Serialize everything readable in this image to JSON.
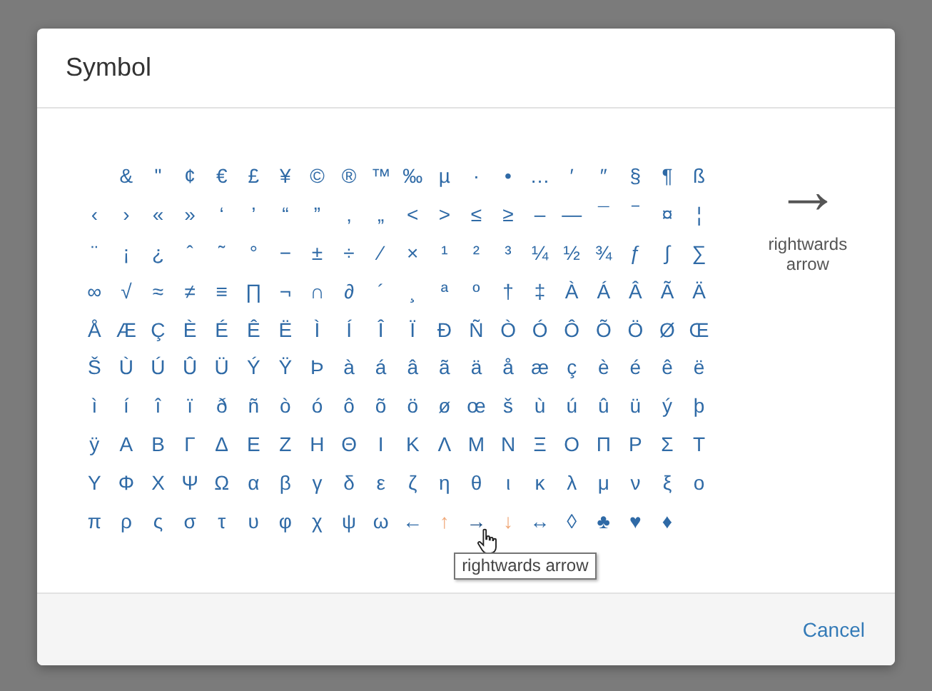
{
  "dialog": {
    "title": "Symbol",
    "grid": [
      {
        "indented": true,
        "cells": [
          {
            "char": "&",
            "hovered": false
          },
          {
            "char": "\"",
            "hovered": false
          },
          {
            "char": "¢",
            "hovered": false
          },
          {
            "char": "€",
            "hovered": false
          },
          {
            "char": "£",
            "hovered": false
          },
          {
            "char": "¥",
            "hovered": false
          },
          {
            "char": "©",
            "hovered": false
          },
          {
            "char": "®",
            "hovered": false
          },
          {
            "char": "™",
            "hovered": false
          },
          {
            "char": "‰",
            "hovered": false
          },
          {
            "char": "µ",
            "hovered": false
          },
          {
            "char": "·",
            "hovered": false
          },
          {
            "char": "•",
            "hovered": false
          },
          {
            "char": "…",
            "hovered": false
          },
          {
            "char": "′",
            "hovered": false
          },
          {
            "char": "″",
            "hovered": false
          },
          {
            "char": "§",
            "hovered": false
          },
          {
            "char": "¶",
            "hovered": false
          },
          {
            "char": "ß",
            "hovered": false
          }
        ]
      },
      {
        "indented": false,
        "cells": [
          {
            "char": "‹",
            "hovered": false
          },
          {
            "char": "›",
            "hovered": false
          },
          {
            "char": "«",
            "hovered": false
          },
          {
            "char": "»",
            "hovered": false
          },
          {
            "char": "‘",
            "hovered": false
          },
          {
            "char": "’",
            "hovered": false
          },
          {
            "char": "“",
            "hovered": false
          },
          {
            "char": "”",
            "hovered": false
          },
          {
            "char": "‚",
            "hovered": false
          },
          {
            "char": "„",
            "hovered": false
          },
          {
            "char": "<",
            "hovered": false
          },
          {
            "char": ">",
            "hovered": false
          },
          {
            "char": "≤",
            "hovered": false
          },
          {
            "char": "≥",
            "hovered": false
          },
          {
            "char": "–",
            "hovered": false
          },
          {
            "char": "—",
            "hovered": false
          },
          {
            "char": "¯",
            "hovered": false
          },
          {
            "char": "‾",
            "hovered": false
          },
          {
            "char": "¤",
            "hovered": false
          },
          {
            "char": "¦",
            "hovered": false
          }
        ]
      },
      {
        "indented": false,
        "cells": [
          {
            "char": "¨",
            "hovered": false
          },
          {
            "char": "¡",
            "hovered": false
          },
          {
            "char": "¿",
            "hovered": false
          },
          {
            "char": "ˆ",
            "hovered": false
          },
          {
            "char": "˜",
            "hovered": false
          },
          {
            "char": "°",
            "hovered": false
          },
          {
            "char": "−",
            "hovered": false
          },
          {
            "char": "±",
            "hovered": false
          },
          {
            "char": "÷",
            "hovered": false
          },
          {
            "char": "⁄",
            "hovered": false
          },
          {
            "char": "×",
            "hovered": false
          },
          {
            "char": "¹",
            "hovered": false
          },
          {
            "char": "²",
            "hovered": false
          },
          {
            "char": "³",
            "hovered": false
          },
          {
            "char": "¼",
            "hovered": false
          },
          {
            "char": "½",
            "hovered": false
          },
          {
            "char": "¾",
            "hovered": false
          },
          {
            "char": "ƒ",
            "hovered": false
          },
          {
            "char": "∫",
            "hovered": false
          },
          {
            "char": "∑",
            "hovered": false
          }
        ]
      },
      {
        "indented": false,
        "cells": [
          {
            "char": "∞",
            "hovered": false
          },
          {
            "char": "√",
            "hovered": false
          },
          {
            "char": "≈",
            "hovered": false
          },
          {
            "char": "≠",
            "hovered": false
          },
          {
            "char": "≡",
            "hovered": false
          },
          {
            "char": "∏",
            "hovered": false
          },
          {
            "char": "¬",
            "hovered": false
          },
          {
            "char": "∩",
            "hovered": false
          },
          {
            "char": "∂",
            "hovered": false
          },
          {
            "char": "´",
            "hovered": false
          },
          {
            "char": "¸",
            "hovered": false
          },
          {
            "char": "ª",
            "hovered": false
          },
          {
            "char": "º",
            "hovered": false
          },
          {
            "char": "†",
            "hovered": false
          },
          {
            "char": "‡",
            "hovered": false
          },
          {
            "char": "À",
            "hovered": false
          },
          {
            "char": "Á",
            "hovered": false
          },
          {
            "char": "Â",
            "hovered": false
          },
          {
            "char": "Ã",
            "hovered": false
          },
          {
            "char": "Ä",
            "hovered": false
          }
        ]
      },
      {
        "indented": false,
        "cells": [
          {
            "char": "Å",
            "hovered": false
          },
          {
            "char": "Æ",
            "hovered": false
          },
          {
            "char": "Ç",
            "hovered": false
          },
          {
            "char": "È",
            "hovered": false
          },
          {
            "char": "É",
            "hovered": false
          },
          {
            "char": "Ê",
            "hovered": false
          },
          {
            "char": "Ë",
            "hovered": false
          },
          {
            "char": "Ì",
            "hovered": false
          },
          {
            "char": "Í",
            "hovered": false
          },
          {
            "char": "Î",
            "hovered": false
          },
          {
            "char": "Ï",
            "hovered": false
          },
          {
            "char": "Ð",
            "hovered": false
          },
          {
            "char": "Ñ",
            "hovered": false
          },
          {
            "char": "Ò",
            "hovered": false
          },
          {
            "char": "Ó",
            "hovered": false
          },
          {
            "char": "Ô",
            "hovered": false
          },
          {
            "char": "Õ",
            "hovered": false
          },
          {
            "char": "Ö",
            "hovered": false
          },
          {
            "char": "Ø",
            "hovered": false
          },
          {
            "char": "Œ",
            "hovered": false
          }
        ]
      },
      {
        "indented": false,
        "cells": [
          {
            "char": "Š",
            "hovered": false
          },
          {
            "char": "Ù",
            "hovered": false
          },
          {
            "char": "Ú",
            "hovered": false
          },
          {
            "char": "Û",
            "hovered": false
          },
          {
            "char": "Ü",
            "hovered": false
          },
          {
            "char": "Ý",
            "hovered": false
          },
          {
            "char": "Ÿ",
            "hovered": false
          },
          {
            "char": "Þ",
            "hovered": false
          },
          {
            "char": "à",
            "hovered": false
          },
          {
            "char": "á",
            "hovered": false
          },
          {
            "char": "â",
            "hovered": false
          },
          {
            "char": "ã",
            "hovered": false
          },
          {
            "char": "ä",
            "hovered": false
          },
          {
            "char": "å",
            "hovered": false
          },
          {
            "char": "æ",
            "hovered": false
          },
          {
            "char": "ç",
            "hovered": false
          },
          {
            "char": "è",
            "hovered": false
          },
          {
            "char": "é",
            "hovered": false
          },
          {
            "char": "ê",
            "hovered": false
          },
          {
            "char": "ë",
            "hovered": false
          }
        ]
      },
      {
        "indented": false,
        "cells": [
          {
            "char": "ì",
            "hovered": false
          },
          {
            "char": "í",
            "hovered": false
          },
          {
            "char": "î",
            "hovered": false
          },
          {
            "char": "ï",
            "hovered": false
          },
          {
            "char": "ð",
            "hovered": false
          },
          {
            "char": "ñ",
            "hovered": false
          },
          {
            "char": "ò",
            "hovered": false
          },
          {
            "char": "ó",
            "hovered": false
          },
          {
            "char": "ô",
            "hovered": false
          },
          {
            "char": "õ",
            "hovered": false
          },
          {
            "char": "ö",
            "hovered": false
          },
          {
            "char": "ø",
            "hovered": false
          },
          {
            "char": "œ",
            "hovered": false
          },
          {
            "char": "š",
            "hovered": false
          },
          {
            "char": "ù",
            "hovered": false
          },
          {
            "char": "ú",
            "hovered": false
          },
          {
            "char": "û",
            "hovered": false
          },
          {
            "char": "ü",
            "hovered": false
          },
          {
            "char": "ý",
            "hovered": false
          },
          {
            "char": "þ",
            "hovered": false
          }
        ]
      },
      {
        "indented": false,
        "cells": [
          {
            "char": "ÿ",
            "hovered": false
          },
          {
            "char": "Α",
            "hovered": false
          },
          {
            "char": "Β",
            "hovered": false
          },
          {
            "char": "Γ",
            "hovered": false
          },
          {
            "char": "Δ",
            "hovered": false
          },
          {
            "char": "Ε",
            "hovered": false
          },
          {
            "char": "Ζ",
            "hovered": false
          },
          {
            "char": "Η",
            "hovered": false
          },
          {
            "char": "Θ",
            "hovered": false
          },
          {
            "char": "Ι",
            "hovered": false
          },
          {
            "char": "Κ",
            "hovered": false
          },
          {
            "char": "Λ",
            "hovered": false
          },
          {
            "char": "Μ",
            "hovered": false
          },
          {
            "char": "Ν",
            "hovered": false
          },
          {
            "char": "Ξ",
            "hovered": false
          },
          {
            "char": "Ο",
            "hovered": false
          },
          {
            "char": "Π",
            "hovered": false
          },
          {
            "char": "Ρ",
            "hovered": false
          },
          {
            "char": "Σ",
            "hovered": false
          },
          {
            "char": "Τ",
            "hovered": false
          }
        ]
      },
      {
        "indented": false,
        "cells": [
          {
            "char": "Υ",
            "hovered": false
          },
          {
            "char": "Φ",
            "hovered": false
          },
          {
            "char": "Χ",
            "hovered": false
          },
          {
            "char": "Ψ",
            "hovered": false
          },
          {
            "char": "Ω",
            "hovered": false
          },
          {
            "char": "α",
            "hovered": false
          },
          {
            "char": "β",
            "hovered": false
          },
          {
            "char": "γ",
            "hovered": false
          },
          {
            "char": "δ",
            "hovered": false
          },
          {
            "char": "ε",
            "hovered": false
          },
          {
            "char": "ζ",
            "hovered": false
          },
          {
            "char": "η",
            "hovered": false
          },
          {
            "char": "θ",
            "hovered": false
          },
          {
            "char": "ι",
            "hovered": false
          },
          {
            "char": "κ",
            "hovered": false
          },
          {
            "char": "λ",
            "hovered": false
          },
          {
            "char": "μ",
            "hovered": false
          },
          {
            "char": "ν",
            "hovered": false
          },
          {
            "char": "ξ",
            "hovered": false
          },
          {
            "char": "ο",
            "hovered": false
          }
        ]
      },
      {
        "indented": false,
        "cells": [
          {
            "char": "π",
            "hovered": false
          },
          {
            "char": "ρ",
            "hovered": false
          },
          {
            "char": "ς",
            "hovered": false
          },
          {
            "char": "σ",
            "hovered": false
          },
          {
            "char": "τ",
            "hovered": false
          },
          {
            "char": "υ",
            "hovered": false
          },
          {
            "char": "φ",
            "hovered": false
          },
          {
            "char": "χ",
            "hovered": false
          },
          {
            "char": "ψ",
            "hovered": false
          },
          {
            "char": "ω",
            "hovered": false
          },
          {
            "char": "←",
            "hovered": false
          },
          {
            "char": "↑",
            "hovered": false,
            "color": "#f0a878"
          },
          {
            "char": "→",
            "hovered": true
          },
          {
            "char": "↓",
            "hovered": false,
            "color": "#f0a878"
          },
          {
            "char": "↔",
            "hovered": false
          },
          {
            "char": "◊",
            "hovered": false
          },
          {
            "char": "♣",
            "hovered": false
          },
          {
            "char": "♥",
            "hovered": false
          },
          {
            "char": "♦",
            "hovered": false
          }
        ]
      }
    ],
    "tooltip": "rightwards arrow",
    "preview": {
      "symbol": "→",
      "name": "rightwards arrow"
    },
    "buttons": [
      {
        "label": "Cancel"
      }
    ]
  }
}
